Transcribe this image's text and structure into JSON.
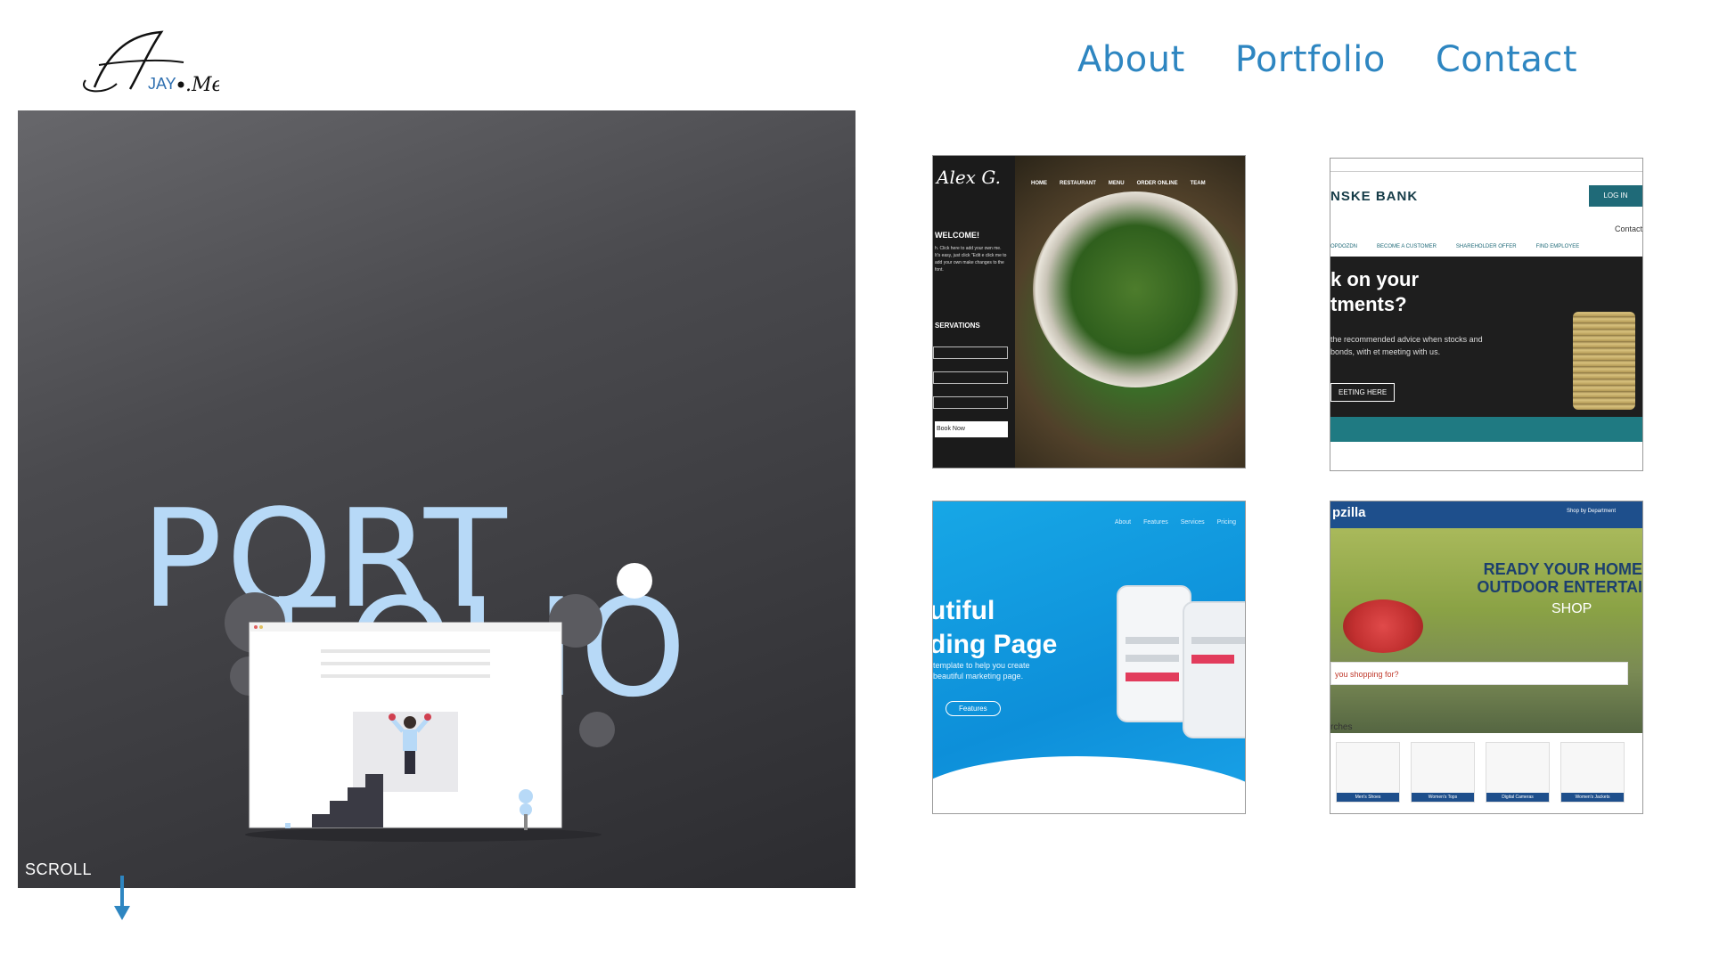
{
  "header": {
    "logo": {
      "text_main": "A",
      "text_accent": "JAY",
      "text_suffix": ".Me"
    },
    "nav": [
      {
        "label": "About"
      },
      {
        "label": "Portfolio"
      },
      {
        "label": "Contact"
      }
    ],
    "nav_color": "#2e86c1"
  },
  "hero": {
    "title_line1": "PORT",
    "title_line2": "FOLIO",
    "title_color": "#b7d9f7",
    "scroll_label": "SCROLL"
  },
  "thumbs": {
    "restaurant": {
      "brand": "Alex G.",
      "nav": [
        "HOME",
        "RESTAURANT",
        "MENU",
        "ORDER ONLINE",
        "TEAM"
      ],
      "welcome": "WELCOME!",
      "blurb": "h. Click here to add your own me. It's easy, just click \"Edit e click me to add your own make changes to the font.",
      "reservations": "SERVATIONS",
      "book": "Book Now"
    },
    "bank": {
      "brand": "NSKE BANK",
      "login": "LOG IN",
      "contact": "Contact",
      "subnav": [
        "OPDOZDN",
        "BECOME A CUSTOMER",
        "SHAREHOLDER OFFER",
        "FIND EMPLOYEE"
      ],
      "headline_1": "k on your",
      "headline_2": "tments?",
      "desc": "the recommended advice when stocks and bonds, with et meeting with us.",
      "button": "EETING HERE"
    },
    "landing": {
      "nav": [
        "About",
        "Features",
        "Services",
        "Pricing"
      ],
      "title_1": "utiful",
      "title_2": "ding Page",
      "sub_1": "template to help you create",
      "sub_2": "beautiful marketing page.",
      "button": "Features"
    },
    "shop": {
      "brand": "pzilla",
      "dept": "Shop by Department",
      "ready_1": "READY YOUR HOME",
      "ready_2": "OUTDOOR ENTERTAI",
      "shop_word": "SHOP",
      "search_placeholder": "you shopping for?",
      "searches": "rches",
      "products": [
        "Men's Shoes",
        "Women's Tops",
        "Digital Cameras",
        "Women's Jackets"
      ]
    }
  }
}
